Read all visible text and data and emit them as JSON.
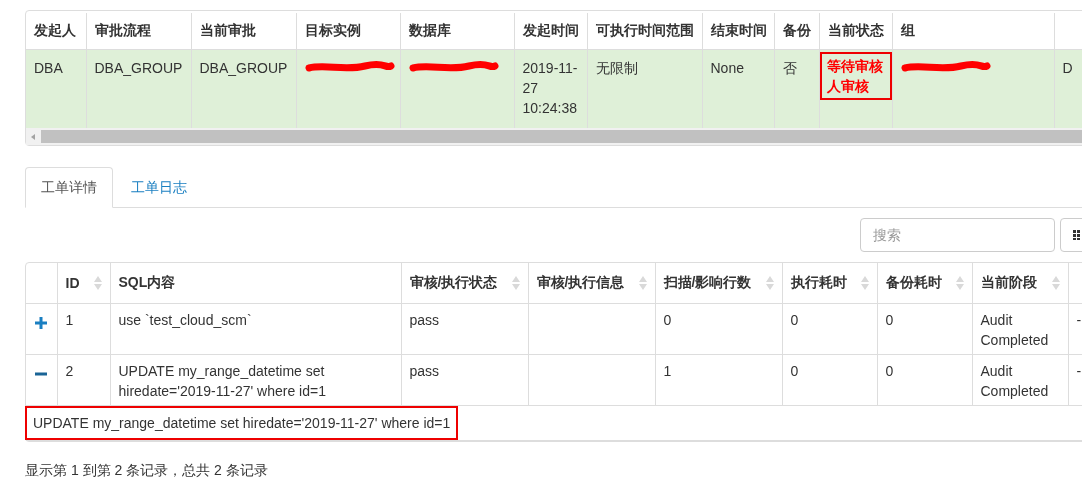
{
  "workflow_table": {
    "columns": [
      "发起人",
      "审批流程",
      "当前审批",
      "目标实例",
      "数据库",
      "发起时间",
      "可执行时间范围",
      "结束时间",
      "备份",
      "当前状态",
      "组"
    ],
    "rows": [
      {
        "cells": [
          {
            "text": "DBA"
          },
          {
            "text": "DBA_GROUP"
          },
          {
            "text": "DBA_GROUP"
          },
          {
            "redacted": true
          },
          {
            "redacted": true
          },
          {
            "text": "2019-11-27 10:24:38"
          },
          {
            "text": "无限制"
          },
          {
            "text": "None"
          },
          {
            "text": "否"
          },
          {
            "text": "等待审核人审核",
            "highlighted": true
          },
          {
            "redacted": true
          },
          {
            "text": "D"
          }
        ]
      }
    ]
  },
  "tabs": [
    {
      "label": "工单详情",
      "selected": true
    },
    {
      "label": "工单日志",
      "selected": false
    }
  ],
  "search": {
    "placeholder": "搜索"
  },
  "sql_table": {
    "columns": [
      {
        "label": "ID",
        "sortable": true
      },
      {
        "label": "SQL内容",
        "sortable": false
      },
      {
        "label": "审核/执行状态",
        "sortable": true
      },
      {
        "label": "审核/执行信息",
        "sortable": true
      },
      {
        "label": "扫描/影响行数",
        "sortable": true
      },
      {
        "label": "执行耗时",
        "sortable": true
      },
      {
        "label": "备份耗时",
        "sortable": true
      },
      {
        "label": "当前阶段",
        "sortable": true
      }
    ],
    "rows": [
      {
        "expanded": false,
        "id": "1",
        "sql": "use `test_cloud_scm`",
        "status": "pass",
        "rows": "0",
        "exec_time": "0",
        "backup_time": "0",
        "stage": "Audit Completed",
        "column_10": "-"
      },
      {
        "expanded": true,
        "id": "2",
        "sql": "UPDATE my_range_datetime set hiredate='2019-11-27' where id=1",
        "status": "pass",
        "rows": "1",
        "exec_time": "0",
        "backup_time": "0",
        "stage": "Audit Completed",
        "column_10": "-",
        "detail": "UPDATE my_range_datetime set hiredate='2019-11-27' where id=1"
      }
    ]
  },
  "pagination_info": "显示第 1 到第 2 条记录，总共 2 条记录"
}
